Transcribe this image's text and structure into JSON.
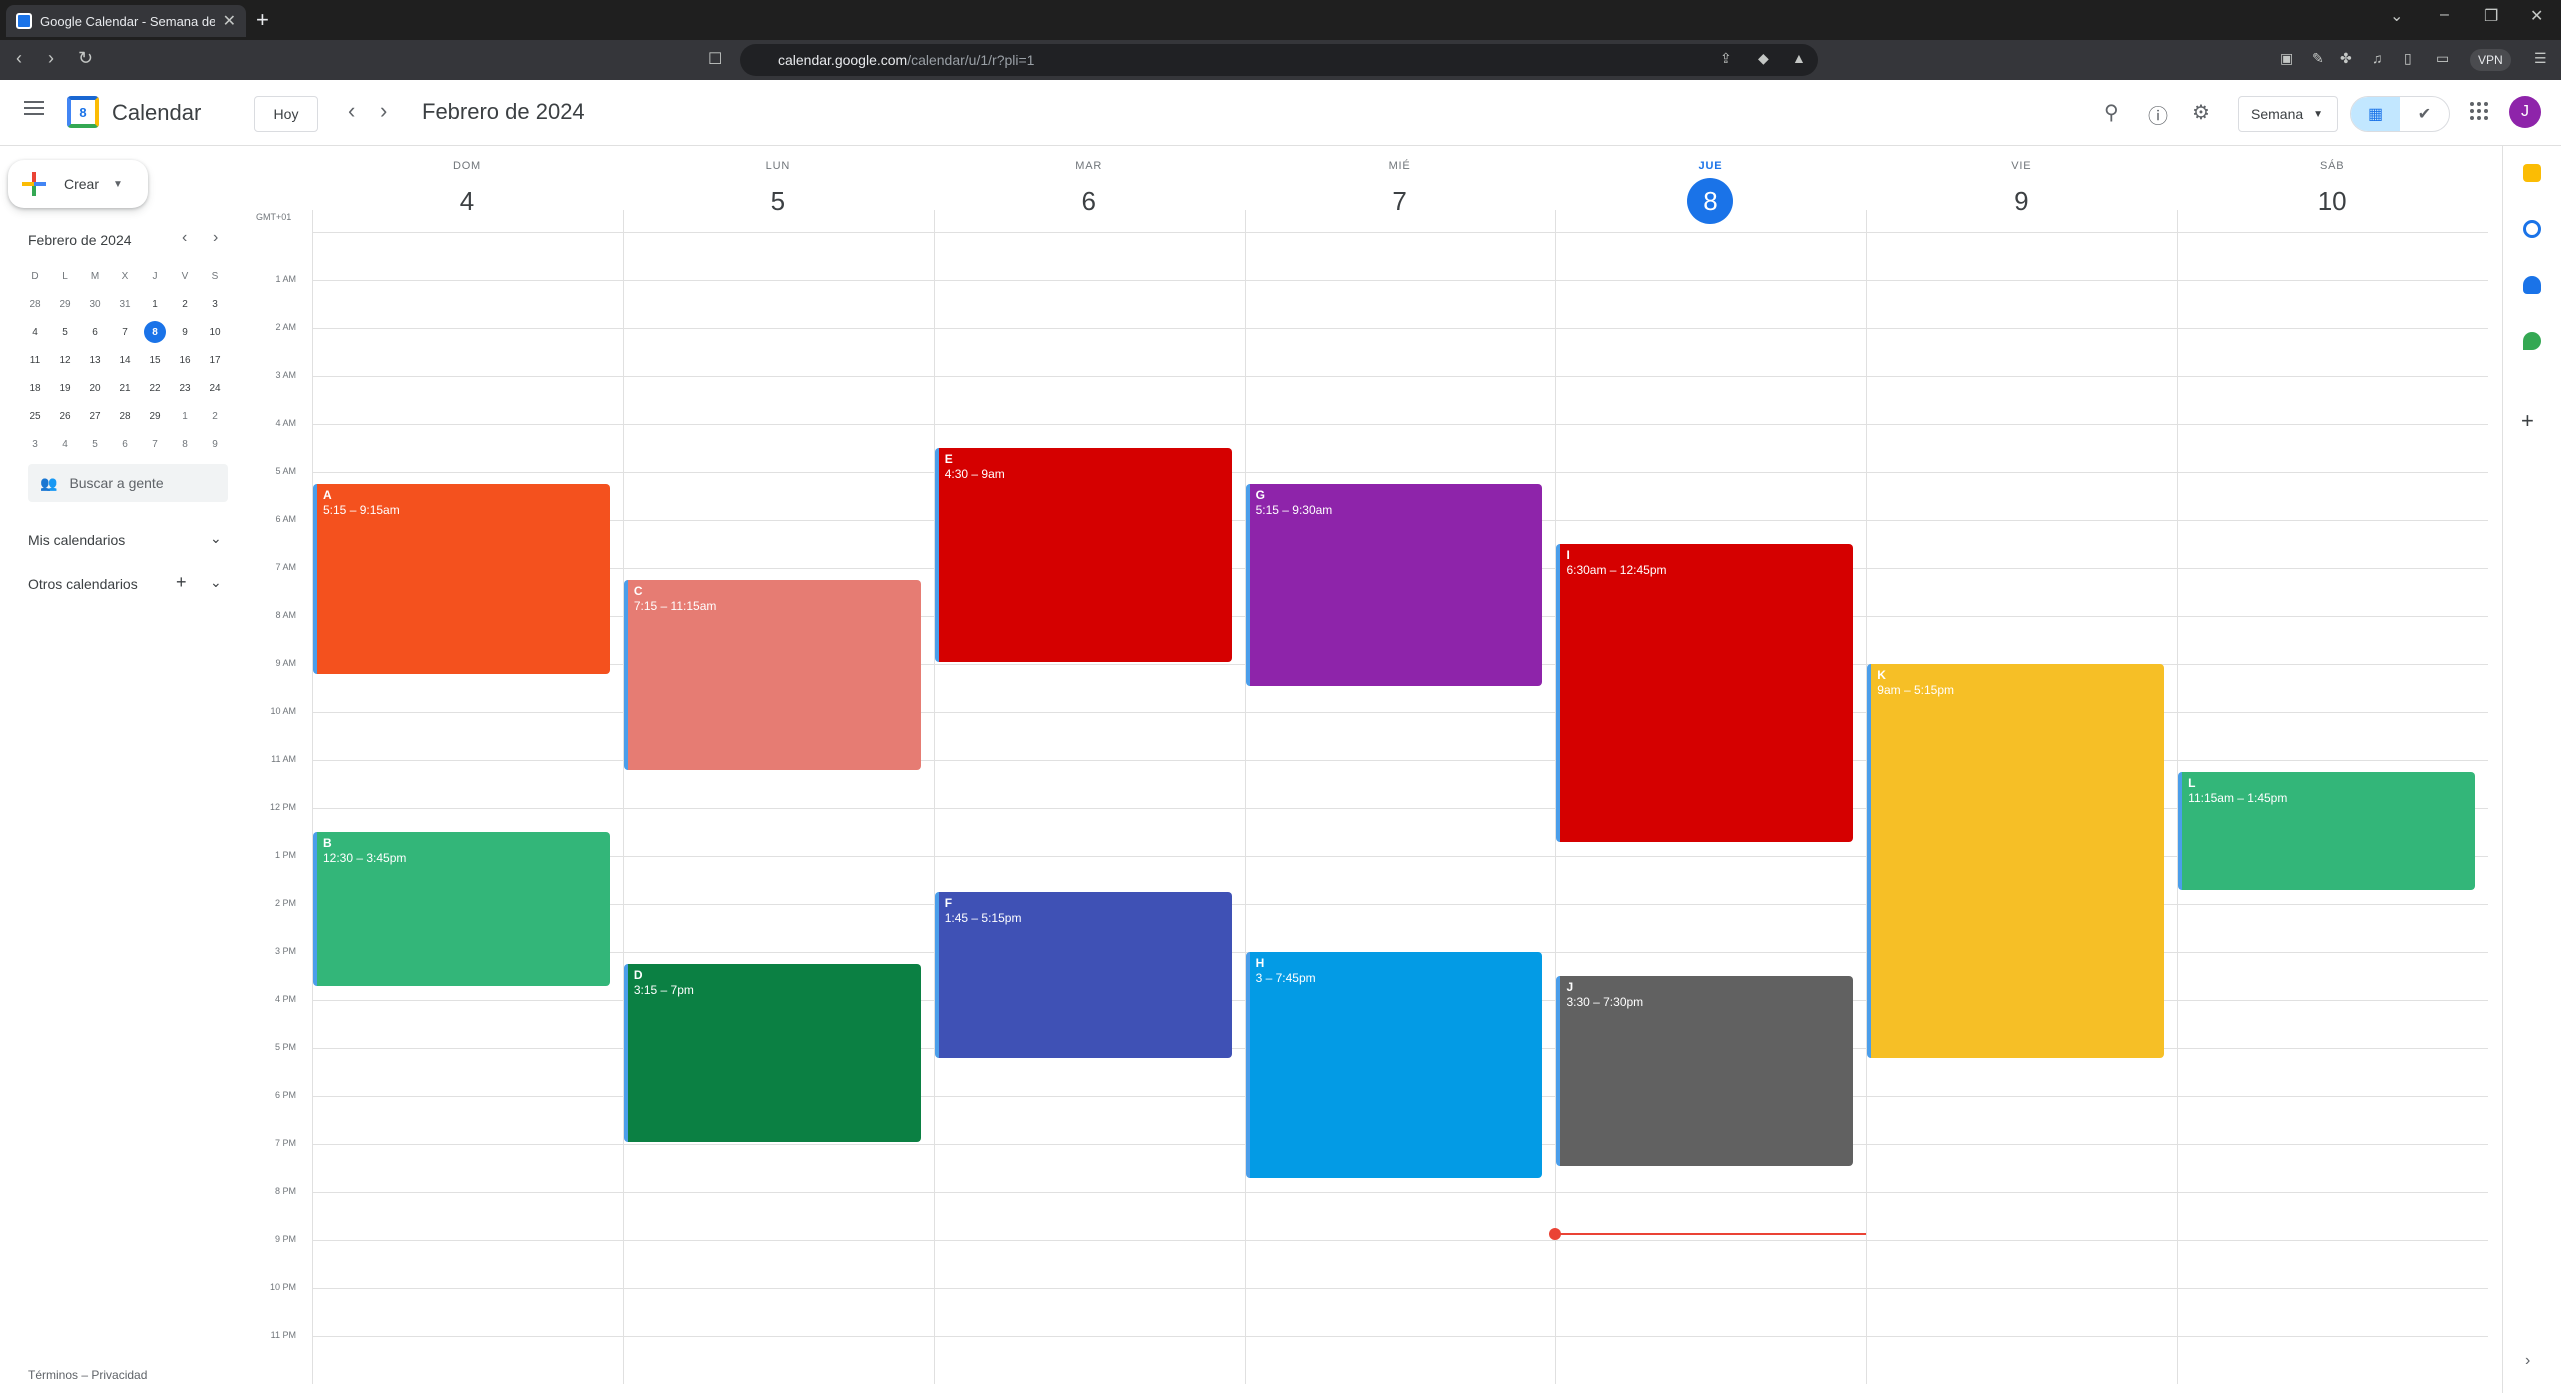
{
  "browser": {
    "tab_title": "Google Calendar - Semana del",
    "url_host": "calendar.google.com",
    "url_path": "/calendar/u/1/r?pli=1",
    "vpn_label": "VPN"
  },
  "header": {
    "app_title": "Calendar",
    "logo_day": "8",
    "today_label": "Hoy",
    "date_title": "Febrero de 2024",
    "view_label": "Semana",
    "avatar_initial": "J"
  },
  "sidebar": {
    "create_label": "Crear",
    "mini_month": "Febrero de 2024",
    "weekday_initials": [
      "D",
      "L",
      "M",
      "X",
      "J",
      "V",
      "S"
    ],
    "mini_weeks": [
      [
        "28",
        "29",
        "30",
        "31",
        "1",
        "2",
        "3"
      ],
      [
        "4",
        "5",
        "6",
        "7",
        "8",
        "9",
        "10"
      ],
      [
        "11",
        "12",
        "13",
        "14",
        "15",
        "16",
        "17"
      ],
      [
        "18",
        "19",
        "20",
        "21",
        "22",
        "23",
        "24"
      ],
      [
        "25",
        "26",
        "27",
        "28",
        "29",
        "1",
        "2"
      ],
      [
        "3",
        "4",
        "5",
        "6",
        "7",
        "8",
        "9"
      ]
    ],
    "mini_selected": "8",
    "search_people_placeholder": "Buscar a gente",
    "my_calendars": "Mis calendarios",
    "other_calendars": "Otros calendarios",
    "footer": "Términos – Privacidad"
  },
  "week": {
    "timezone": "GMT+01",
    "days": [
      {
        "dow": "DOM",
        "num": "4"
      },
      {
        "dow": "LUN",
        "num": "5"
      },
      {
        "dow": "MAR",
        "num": "6"
      },
      {
        "dow": "MIÉ",
        "num": "7"
      },
      {
        "dow": "JUE",
        "num": "8",
        "today": true
      },
      {
        "dow": "VIE",
        "num": "9"
      },
      {
        "dow": "SÁB",
        "num": "10"
      }
    ],
    "hours": [
      "",
      "1 AM",
      "2 AM",
      "3 AM",
      "4 AM",
      "5 AM",
      "6 AM",
      "7 AM",
      "8 AM",
      "9 AM",
      "10 AM",
      "11 AM",
      "12 PM",
      "1 PM",
      "2 PM",
      "3 PM",
      "4 PM",
      "5 PM",
      "6 PM",
      "7 PM",
      "8 PM",
      "9 PM",
      "10 PM",
      "11 PM"
    ],
    "current_time_hours": 20.88
  },
  "events": [
    {
      "name": "A",
      "time": "5:15 – 9:15am",
      "day": 0,
      "start": 5.25,
      "end": 9.25,
      "color": "#f4511e"
    },
    {
      "name": "B",
      "time": "12:30 – 3:45pm",
      "day": 0,
      "start": 12.5,
      "end": 15.75,
      "color": "#33b679"
    },
    {
      "name": "C",
      "time": "7:15 – 11:15am",
      "day": 1,
      "start": 7.25,
      "end": 11.25,
      "color": "#e67c73"
    },
    {
      "name": "D",
      "time": "3:15 – 7pm",
      "day": 1,
      "start": 15.25,
      "end": 19.0,
      "color": "#0b8043"
    },
    {
      "name": "E",
      "time": "4:30 – 9am",
      "day": 2,
      "start": 4.5,
      "end": 9.0,
      "color": "#d50000"
    },
    {
      "name": "F",
      "time": "1:45 – 5:15pm",
      "day": 2,
      "start": 13.75,
      "end": 17.25,
      "color": "#3f51b5"
    },
    {
      "name": "G",
      "time": "5:15 – 9:30am",
      "day": 3,
      "start": 5.25,
      "end": 9.5,
      "color": "#8e24aa"
    },
    {
      "name": "H",
      "time": "3 – 7:45pm",
      "day": 3,
      "start": 15.0,
      "end": 19.75,
      "color": "#039be5"
    },
    {
      "name": "I",
      "time": "6:30am – 12:45pm",
      "day": 4,
      "start": 6.5,
      "end": 12.75,
      "color": "#d50000"
    },
    {
      "name": "J",
      "time": "3:30 – 7:30pm",
      "day": 4,
      "start": 15.5,
      "end": 19.5,
      "color": "#616161"
    },
    {
      "name": "K",
      "time": "9am – 5:15pm",
      "day": 5,
      "start": 9.0,
      "end": 17.25,
      "color": "#f6bf26"
    },
    {
      "name": "L",
      "time": "11:15am – 1:45pm",
      "day": 6,
      "start": 11.25,
      "end": 13.75,
      "color": "#33b679"
    }
  ]
}
